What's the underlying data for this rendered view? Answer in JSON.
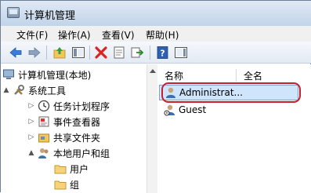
{
  "window": {
    "title": "计算机管理"
  },
  "menu": [
    {
      "label": "文件(F)"
    },
    {
      "label": "操作(A)"
    },
    {
      "label": "查看(V)"
    },
    {
      "label": "帮助(H)"
    }
  ],
  "toolbar": {
    "buttons": [
      "back-icon",
      "forward-icon",
      "up-folder-icon",
      "show-tree-icon",
      "delete-icon",
      "properties-icon",
      "export-icon",
      "help-icon",
      "action-pane-icon"
    ]
  },
  "tree": {
    "items": [
      {
        "label": "计算机管理(本地)",
        "icon": "computer-icon",
        "expander": ""
      },
      {
        "label": "系统工具",
        "icon": "tools-icon",
        "expander": "▲"
      },
      {
        "label": "任务计划程序",
        "icon": "clock-icon",
        "expander": "▷"
      },
      {
        "label": "事件查看器",
        "icon": "event-viewer-icon",
        "expander": "▷"
      },
      {
        "label": "共享文件夹",
        "icon": "shared-folder-icon",
        "expander": "▷"
      },
      {
        "label": "本地用户和组",
        "icon": "users-icon",
        "expander": "▲"
      },
      {
        "label": "用户",
        "icon": "folder-icon",
        "expander": ""
      },
      {
        "label": "组",
        "icon": "folder-icon",
        "expander": ""
      }
    ]
  },
  "list": {
    "columns": [
      "名称",
      "全名"
    ],
    "rows": [
      {
        "name": "Administrat...",
        "selected": true
      },
      {
        "name": "Guest",
        "selected": false
      }
    ]
  },
  "colors": {
    "selection": "#cfe5fb",
    "highlight_ring": "#c8202a"
  }
}
